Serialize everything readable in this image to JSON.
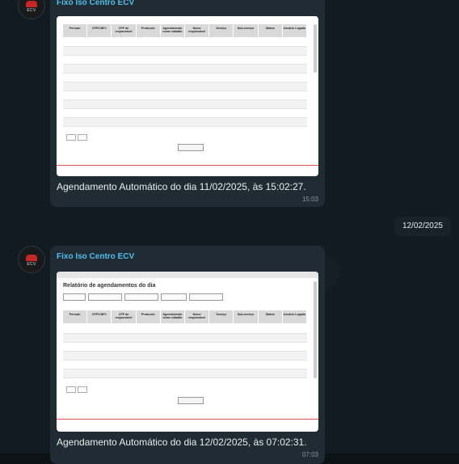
{
  "messages": [
    {
      "sender": "Fixo Iso Centro ECV",
      "avatar_text": "ECV",
      "caption": "Agendamento Automático do dia 11/02/2025, às 15:02:27.",
      "time": "15:03"
    },
    {
      "sender": "Fixo Iso Centro ECV",
      "avatar_text": "ECV",
      "caption": "Agendamento Automático do dia 12/02/2025, às 07:02:31.",
      "time": "07:03",
      "report_title": "Relatório de agendamentos do dia"
    }
  ],
  "date_divider": "12/02/2025",
  "table_headers": [
    "Período",
    "CPF/CNPJ",
    "CPF do responsável",
    "Protocolo",
    "Agendamento nome cidadão",
    "Nome responsável",
    "Serviço",
    "Sub-serviço",
    "Status",
    "Usuário Logado"
  ],
  "export_label": "Exportar Excel",
  "colors": {
    "sender": "#53bdeb",
    "bubble": "#202c33",
    "background": "#111b21"
  }
}
